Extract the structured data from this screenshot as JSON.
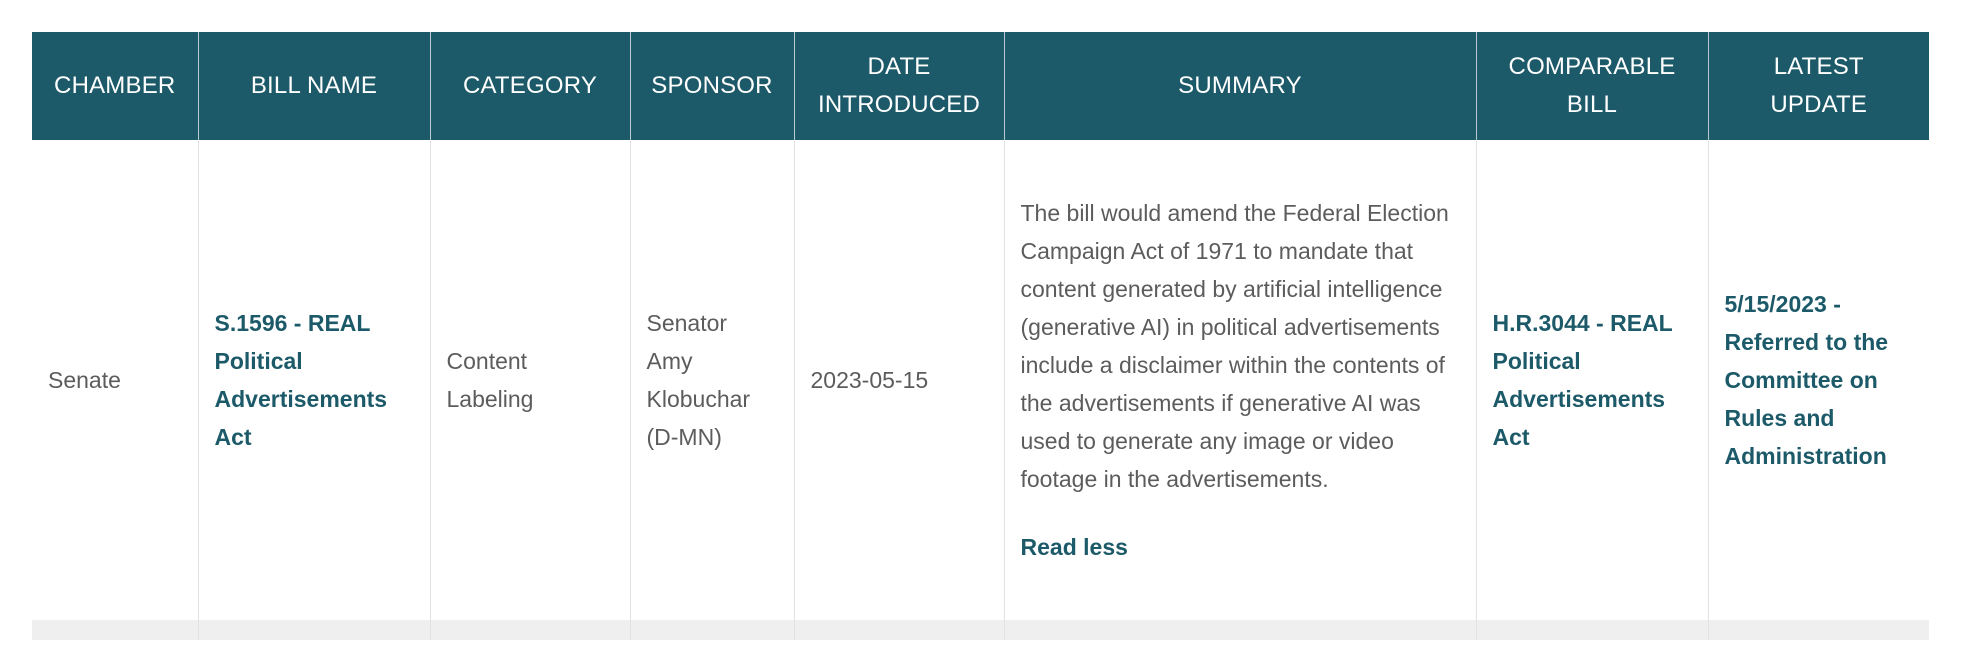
{
  "colors": {
    "header_bg": "#1d5a69",
    "header_text": "#ffffff",
    "link": "#1d5a69",
    "body_text": "#5c5c5c",
    "alt_row_bg": "#efefef"
  },
  "table": {
    "headers": [
      {
        "lines": [
          "CHAMBER"
        ]
      },
      {
        "lines": [
          "BILL NAME"
        ]
      },
      {
        "lines": [
          "CATEGORY"
        ]
      },
      {
        "lines": [
          "SPONSOR"
        ]
      },
      {
        "lines": [
          "DATE",
          "INTRODUCED"
        ]
      },
      {
        "lines": [
          "SUMMARY"
        ]
      },
      {
        "lines": [
          "COMPARABLE",
          "BILL"
        ]
      },
      {
        "lines": [
          "LATEST",
          "UPDATE"
        ]
      }
    ],
    "rows": [
      {
        "chamber": "Senate",
        "bill_name": "S.1596 - REAL Political Advertisements Act",
        "category": "Content Labeling",
        "sponsor": "Senator Amy Klobuchar (D-MN)",
        "date_introduced": "2023-05-15",
        "summary": "The bill would amend the Federal Election Campaign Act of 1971 to mandate that content generated by artificial intelligence (generative AI) in political advertisements include a disclaimer within the contents of the advertisements if generative AI was used to generate any image or video footage in the advertisements.",
        "read_toggle_label": "Read less",
        "comparable_bill": "H.R.3044 - REAL Political Advertisements Act",
        "latest_update": "5/15/2023 - Referred to the Committee on Rules and Administration"
      }
    ]
  }
}
